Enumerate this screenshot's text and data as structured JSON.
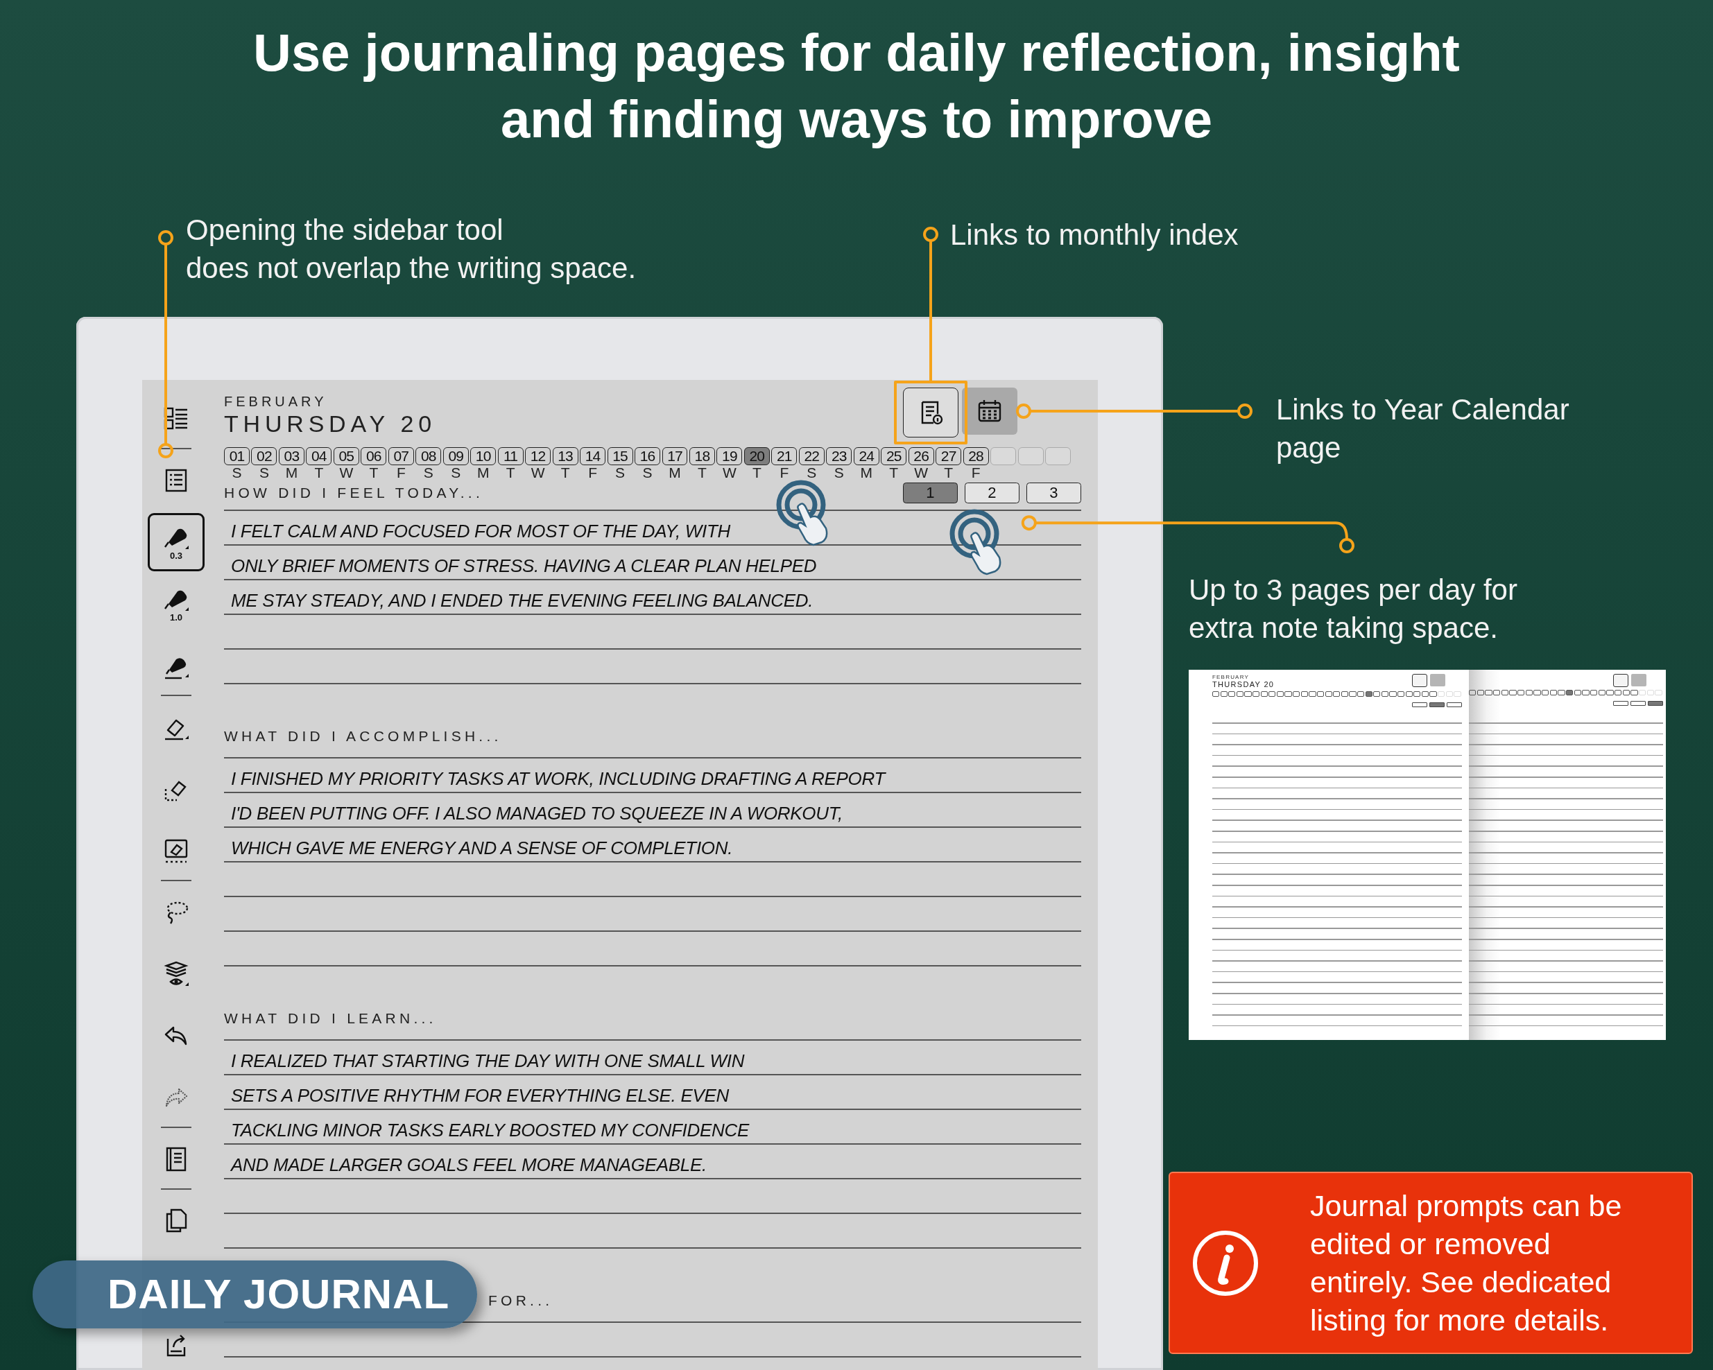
{
  "headline": "Use journaling pages for daily reflection, insight\nand finding ways to improve",
  "callouts": [
    {
      "text": "Opening the sidebar tool\ndoes not overlap the writing space."
    },
    {
      "text": "Links to monthly index"
    },
    {
      "text": "Links to Year Calendar\npage"
    },
    {
      "text": "Up to 3 pages per day for\nextra note taking space."
    }
  ],
  "journal": {
    "sidebar": [
      {
        "kind": "layout",
        "selected": false
      },
      {
        "kind": "list",
        "selected": false
      },
      {
        "kind": "pen",
        "selected": true,
        "label": "0.3"
      },
      {
        "kind": "pen",
        "selected": false,
        "label": "1.0"
      },
      {
        "kind": "marker",
        "selected": false
      },
      {
        "kind": "eraser",
        "selected": false
      },
      {
        "kind": "area-eraser",
        "selected": false
      },
      {
        "kind": "erase-box",
        "selected": false
      },
      {
        "kind": "lasso",
        "selected": false
      },
      {
        "kind": "layers",
        "selected": false
      },
      {
        "kind": "undo",
        "selected": false
      },
      {
        "kind": "redo",
        "selected": false
      },
      {
        "kind": "notebook",
        "selected": false
      },
      {
        "kind": "copy",
        "selected": false
      },
      {
        "kind": "export",
        "selected": false
      }
    ],
    "month": "FEBRUARY",
    "date": "THURSDAY 20",
    "days": [
      {
        "label": "01",
        "selected": false
      },
      {
        "label": "02",
        "selected": false
      },
      {
        "label": "03",
        "selected": false
      },
      {
        "label": "04",
        "selected": false
      },
      {
        "label": "05",
        "selected": false
      },
      {
        "label": "06",
        "selected": false
      },
      {
        "label": "07",
        "selected": false
      },
      {
        "label": "08",
        "selected": false
      },
      {
        "label": "09",
        "selected": false
      },
      {
        "label": "10",
        "selected": false
      },
      {
        "label": "11",
        "selected": false
      },
      {
        "label": "12",
        "selected": false
      },
      {
        "label": "13",
        "selected": false
      },
      {
        "label": "14",
        "selected": false
      },
      {
        "label": "15",
        "selected": false
      },
      {
        "label": "16",
        "selected": false
      },
      {
        "label": "17",
        "selected": false
      },
      {
        "label": "18",
        "selected": false
      },
      {
        "label": "19",
        "selected": false
      },
      {
        "label": "20",
        "selected": true
      },
      {
        "label": "21",
        "selected": false
      },
      {
        "label": "22",
        "selected": false
      },
      {
        "label": "23",
        "selected": false
      },
      {
        "label": "24",
        "selected": false
      },
      {
        "label": "25",
        "selected": false
      },
      {
        "label": "26",
        "selected": false
      },
      {
        "label": "27",
        "selected": false
      },
      {
        "label": "28",
        "selected": false
      }
    ],
    "weekdays": [
      "S",
      "S",
      "M",
      "T",
      "W",
      "T",
      "F",
      "S",
      "S",
      "M",
      "T",
      "W",
      "T",
      "F",
      "S",
      "S",
      "M",
      "T",
      "W",
      "T",
      "F",
      "S",
      "S",
      "M",
      "T",
      "W",
      "T",
      "F"
    ],
    "page_buttons": [
      {
        "label": "1",
        "selected": true
      },
      {
        "label": "2",
        "selected": false
      },
      {
        "label": "3",
        "selected": false
      }
    ],
    "sections": [
      {
        "heading": "HOW DID I FEEL TODAY...",
        "lines": [
          "I FELT CALM AND FOCUSED FOR MOST OF THE DAY, WITH",
          "ONLY BRIEF MOMENTS OF STRESS. HAVING A CLEAR PLAN HELPED",
          "ME STAY STEADY, AND I ENDED THE EVENING FEELING BALANCED."
        ]
      },
      {
        "heading": "WHAT DID I ACCOMPLISH...",
        "lines": [
          "I FINISHED MY PRIORITY TASKS AT WORK, INCLUDING DRAFTING A REPORT",
          "I'D BEEN PUTTING OFF. I ALSO MANAGED TO SQUEEZE IN A WORKOUT,",
          "WHICH GAVE ME ENERGY AND A SENSE OF COMPLETION."
        ]
      },
      {
        "heading": "WHAT DID I LEARN...",
        "lines": [
          "I REALIZED THAT STARTING THE DAY WITH ONE SMALL WIN",
          "SETS A POSITIVE RHYTHM FOR EVERYTHING ELSE. EVEN",
          "TACKLING MINOR TASKS EARLY BOOSTED MY CONFIDENCE",
          "AND MADE LARGER GOALS FEEL MORE MANAGEABLE."
        ]
      },
      {
        "heading": "FOR..."
      }
    ]
  },
  "preview": {
    "pages": [
      {
        "month": "FEBRUARY",
        "date": "THURSDAY 20",
        "days": [
          {
            "selected": false
          },
          {
            "selected": false
          },
          {
            "selected": false
          },
          {
            "selected": false
          },
          {
            "selected": false
          },
          {
            "selected": false
          },
          {
            "selected": false
          },
          {
            "selected": false
          },
          {
            "selected": false
          },
          {
            "selected": false
          },
          {
            "selected": false
          },
          {
            "selected": false
          },
          {
            "selected": false
          },
          {
            "selected": false
          },
          {
            "selected": false
          },
          {
            "selected": false
          },
          {
            "selected": false
          },
          {
            "selected": false
          },
          {
            "selected": false
          },
          {
            "selected": true
          },
          {
            "selected": false
          },
          {
            "selected": false
          },
          {
            "selected": false
          },
          {
            "selected": false
          },
          {
            "selected": false
          },
          {
            "selected": false
          },
          {
            "selected": false
          },
          {
            "selected": false
          }
        ],
        "page_buttons": [
          {
            "selected": false
          },
          {
            "selected": true
          },
          {
            "selected": false
          }
        ]
      },
      {
        "days": [
          {
            "selected": false
          },
          {
            "selected": false
          },
          {
            "selected": false
          },
          {
            "selected": false
          },
          {
            "selected": false
          },
          {
            "selected": false
          },
          {
            "selected": false
          },
          {
            "selected": false
          },
          {
            "selected": false
          },
          {
            "selected": false
          },
          {
            "selected": false
          },
          {
            "selected": false
          },
          {
            "selected": true
          },
          {
            "selected": false
          },
          {
            "selected": false
          },
          {
            "selected": false
          },
          {
            "selected": false
          },
          {
            "selected": false
          },
          {
            "selected": false
          },
          {
            "selected": false
          },
          {
            "selected": false
          }
        ],
        "page_buttons": [
          {
            "selected": false
          },
          {
            "selected": false
          },
          {
            "selected": true
          }
        ]
      }
    ]
  },
  "note": {
    "text": "Journal prompts can be\nedited or removed\nentirely. See dedicated\nlisting for more details."
  },
  "badge": {
    "text": "DAILY JOURNAL"
  }
}
